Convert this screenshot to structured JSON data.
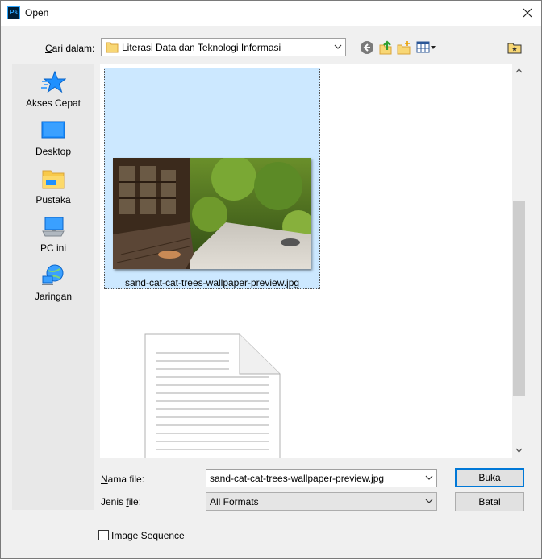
{
  "window": {
    "title": "Open",
    "app_icon_text": "Ps"
  },
  "look_in": {
    "label_prefix": "C",
    "label_rest": "ari dalam:",
    "value": "Literasi Data dan Teknologi Informasi"
  },
  "toolbar": {
    "icons": [
      "back-icon",
      "up-folder-icon",
      "new-folder-icon",
      "view-menu-icon"
    ],
    "extra_icon": "favorite-folder-icon"
  },
  "sidebar": {
    "items": [
      {
        "label": "Akses Cepat",
        "icon": "quick-access-star-icon"
      },
      {
        "label": "Desktop",
        "icon": "desktop-icon"
      },
      {
        "label": "Pustaka",
        "icon": "libraries-icon"
      },
      {
        "label": "PC ini",
        "icon": "this-pc-icon"
      },
      {
        "label": "Jaringan",
        "icon": "network-icon"
      }
    ]
  },
  "files": [
    {
      "name": "sand-cat-cat-trees-wallpaper-preview.jpg",
      "selected": true
    },
    {
      "name": "",
      "type": "document"
    }
  ],
  "filename": {
    "label_prefix": "N",
    "label_rest": "ama file:",
    "value": "sand-cat-cat-trees-wallpaper-preview.jpg"
  },
  "filetype": {
    "label_prefix": "Jenis ",
    "label_u": "f",
    "label_rest": "ile:",
    "value": "All Formats"
  },
  "buttons": {
    "open_u": "B",
    "open_rest": "uka",
    "cancel": "Batal"
  },
  "image_sequence": {
    "label": "Image Sequence",
    "checked": false
  },
  "colors": {
    "selection": "#cce8ff",
    "accent": "#0078d7",
    "sidebar_bg": "#e8e8e8"
  }
}
